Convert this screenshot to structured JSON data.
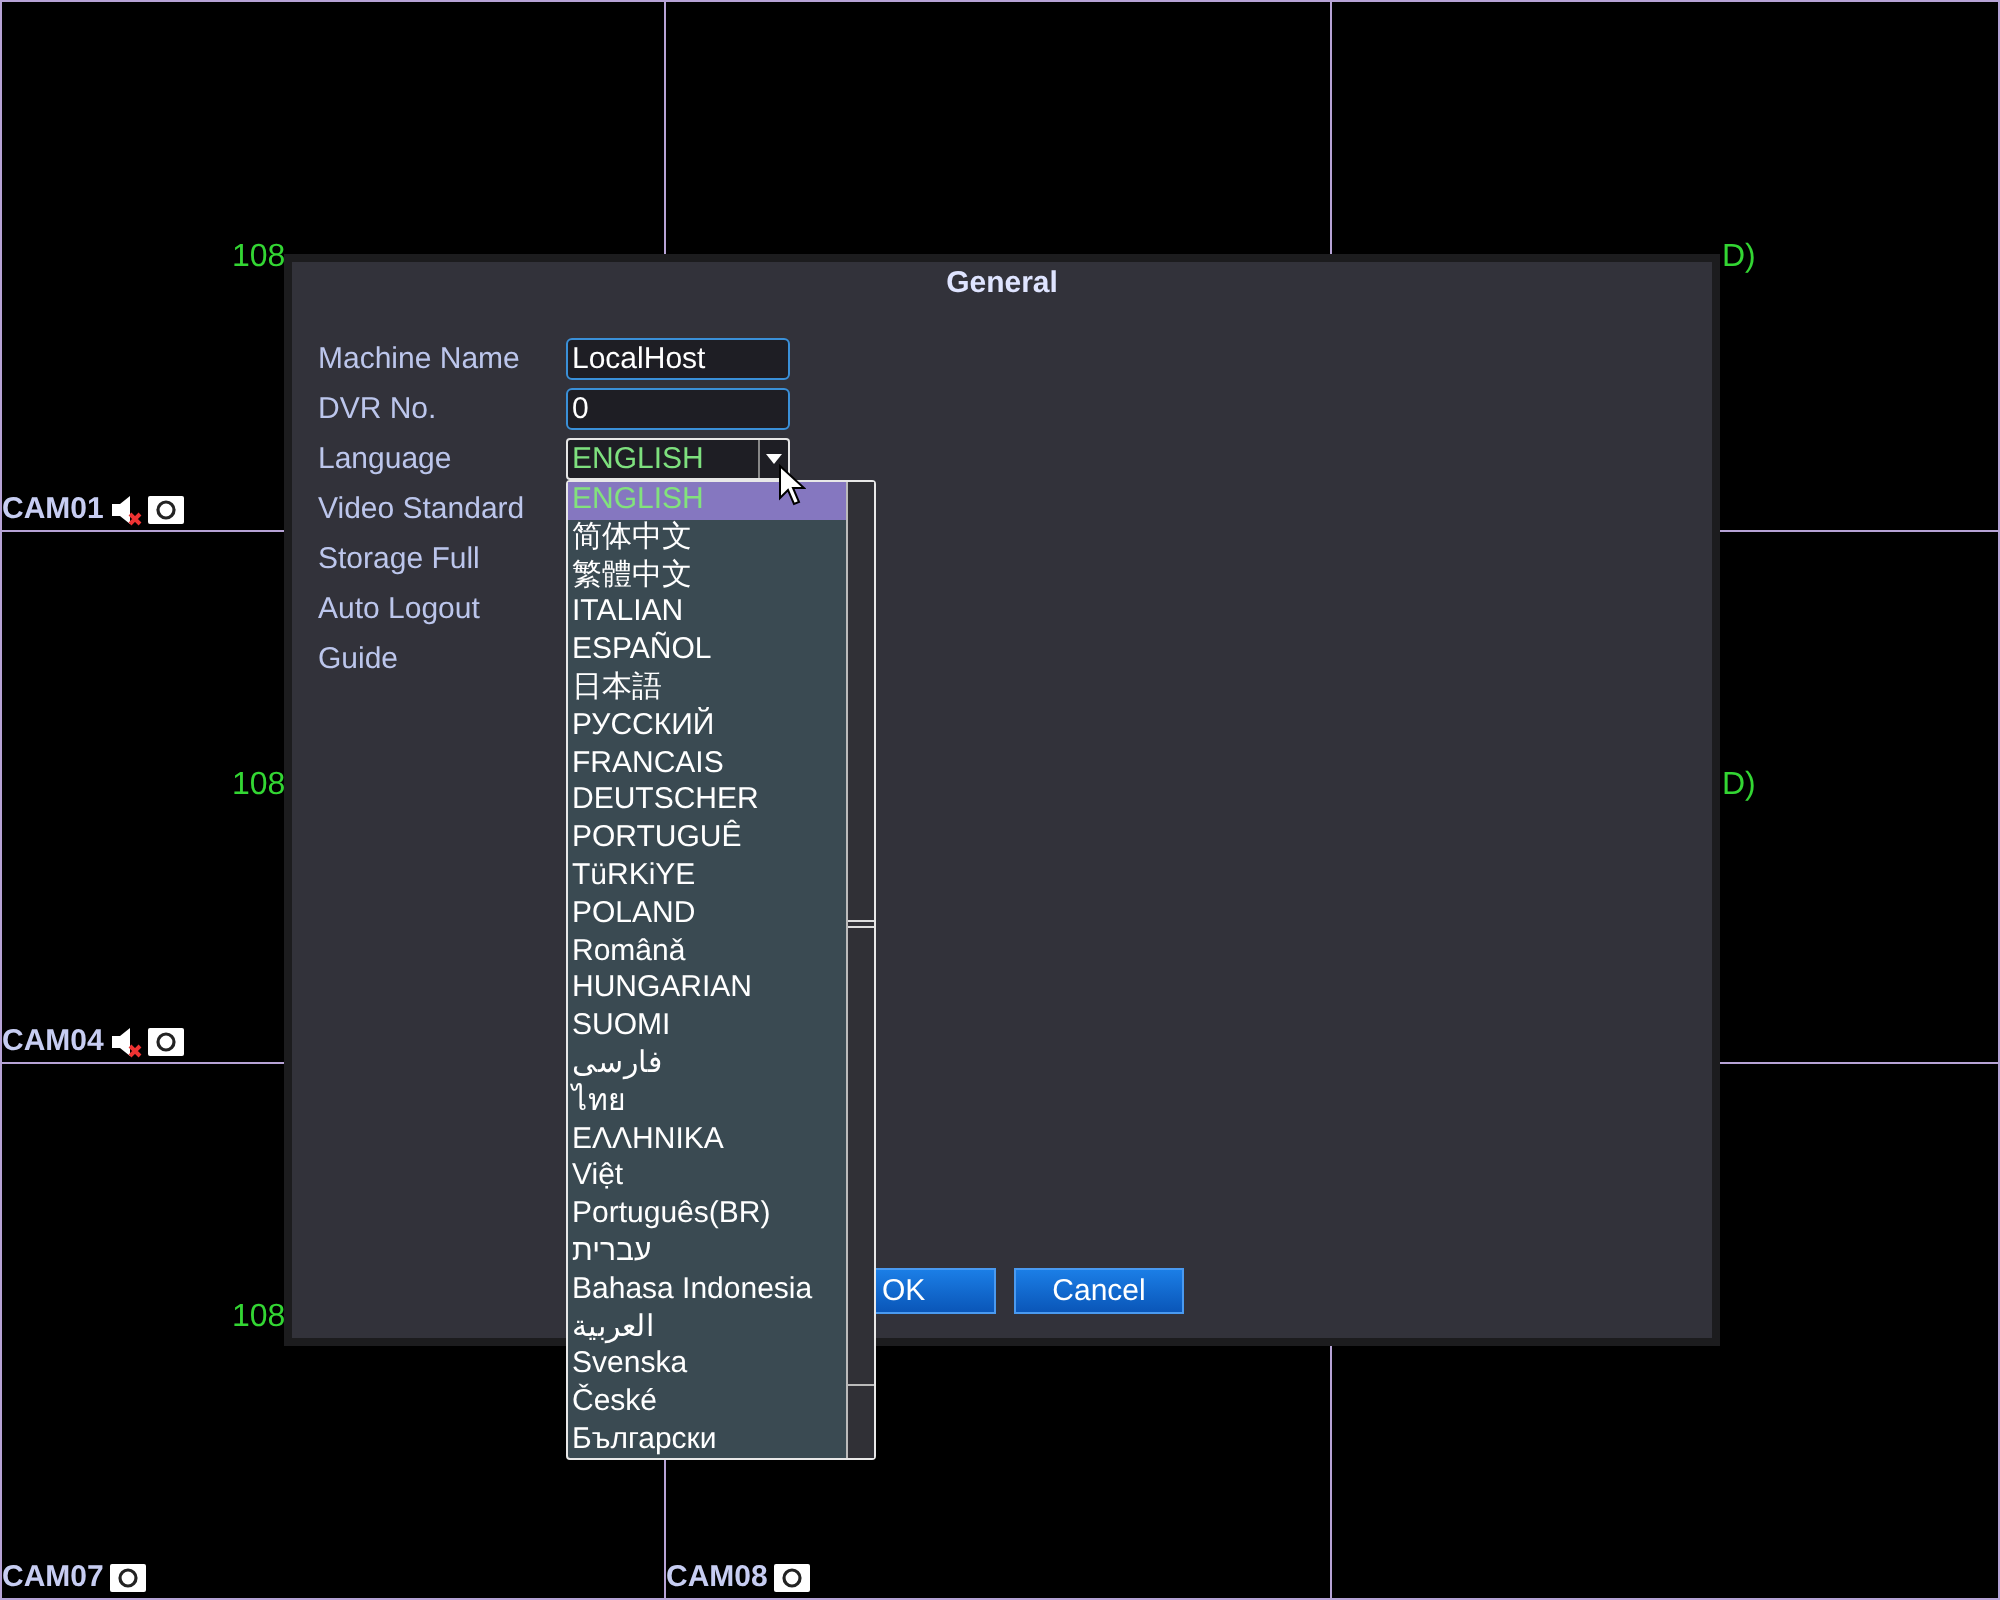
{
  "tile_rows": [
    {
      "left": {
        "resolution": "108",
        "camera": {
          "name": "CAM01",
          "audio_muted": true
        }
      },
      "right": {
        "resolution": "D)"
      }
    },
    {
      "left": {
        "resolution": "108",
        "camera": {
          "name": "CAM04",
          "audio_muted": true
        }
      },
      "right": {
        "resolution": "D)"
      }
    },
    {
      "left": {
        "resolution": "108",
        "camera": {
          "name": "CAM07",
          "audio_muted": false
        }
      },
      "middle": {
        "camera": {
          "name": "CAM08",
          "audio_muted": false
        }
      }
    }
  ],
  "dialog": {
    "title": "General",
    "fields": [
      {
        "label": "Machine Name",
        "kind": "text",
        "value": "LocalHost"
      },
      {
        "label": "DVR No.",
        "kind": "text",
        "value": "0"
      },
      {
        "label": "Language",
        "kind": "dropdown",
        "value": "ENGLISH",
        "expanded": true
      },
      {
        "label": "Video Standard",
        "kind": "label"
      },
      {
        "label": "Storage Full",
        "kind": "label"
      },
      {
        "label": "Auto Logout",
        "kind": "label"
      },
      {
        "label": "Guide",
        "kind": "label"
      }
    ],
    "language_options": [
      {
        "label": "ENGLISH",
        "selected": true
      },
      {
        "label": "简体中文",
        "selected": false
      },
      {
        "label": "繁體中文",
        "selected": false
      },
      {
        "label": "ITALIAN",
        "selected": false
      },
      {
        "label": "ESPAÑOL",
        "selected": false
      },
      {
        "label": "日本語",
        "selected": false
      },
      {
        "label": "РУССКИЙ",
        "selected": false
      },
      {
        "label": "FRANCAIS",
        "selected": false
      },
      {
        "label": "DEUTSCHER",
        "selected": false
      },
      {
        "label": "PORTUGUÊ",
        "selected": false
      },
      {
        "label": "TüRKiYE",
        "selected": false
      },
      {
        "label": "POLAND",
        "selected": false
      },
      {
        "label": "Românǎ",
        "selected": false
      },
      {
        "label": "HUNGARIAN",
        "selected": false
      },
      {
        "label": "SUOMI",
        "selected": false
      },
      {
        "label": "فارسی",
        "selected": false
      },
      {
        "label": "ไทย",
        "selected": false
      },
      {
        "label": "ΕΛΛΗΝΙΚΑ",
        "selected": false
      },
      {
        "label": "Việt",
        "selected": false
      },
      {
        "label": "Português(BR)",
        "selected": false
      },
      {
        "label": "עברית",
        "selected": false
      },
      {
        "label": "Bahasa Indonesia",
        "selected": false
      },
      {
        "label": "العربية",
        "selected": false
      },
      {
        "label": "Svenska",
        "selected": false
      },
      {
        "label": "České",
        "selected": false
      },
      {
        "label": "Български",
        "selected": false
      }
    ],
    "buttons": [
      "OK",
      "Cancel"
    ]
  }
}
